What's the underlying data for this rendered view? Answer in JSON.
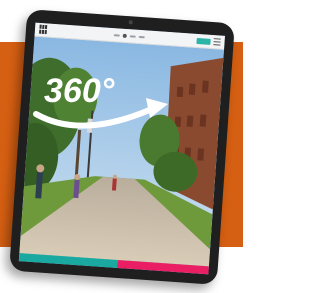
{
  "badge": {
    "label": "360°"
  },
  "colors": {
    "background": "#d55f12",
    "bezel": "#1f1f1f",
    "sky": "#9cc4e6",
    "footer_left": "#1aa9a0",
    "footer_right": "#e91e63",
    "topbar_button": "#2bb5a8"
  },
  "icons": [
    "tablet-device",
    "panorama-arrow-icon"
  ]
}
